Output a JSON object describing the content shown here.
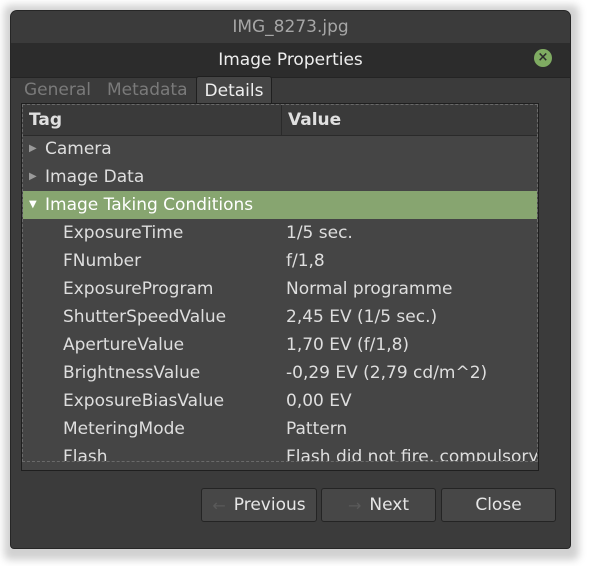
{
  "parent_window": {
    "title": "IMG_8273.jpg"
  },
  "dialog": {
    "title": "Image Properties",
    "close_glyph": "×"
  },
  "tabs": [
    {
      "label": "General",
      "active": false
    },
    {
      "label": "Metadata",
      "active": false
    },
    {
      "label": "Details",
      "active": true
    }
  ],
  "table": {
    "columns": {
      "tag": "Tag",
      "value": "Value"
    },
    "groups": [
      {
        "label": "Camera",
        "expanded": false
      },
      {
        "label": "Image Data",
        "expanded": false
      },
      {
        "label": "Image Taking Conditions",
        "expanded": true
      }
    ],
    "rows": [
      {
        "tag": "ExposureTime",
        "value": "1/5 sec."
      },
      {
        "tag": "FNumber",
        "value": "f/1,8"
      },
      {
        "tag": "ExposureProgram",
        "value": "Normal programme"
      },
      {
        "tag": "ShutterSpeedValue",
        "value": "2,45 EV (1/5 sec.)"
      },
      {
        "tag": "ApertureValue",
        "value": "1,70 EV (f/1,8)"
      },
      {
        "tag": "BrightnessValue",
        "value": "-0,29 EV (2,79 cd/m^2)"
      },
      {
        "tag": "ExposureBiasValue",
        "value": "0,00 EV"
      },
      {
        "tag": "MeteringMode",
        "value": "Pattern"
      },
      {
        "tag": "Flash",
        "value": "Flash did not fire, compulsory"
      }
    ]
  },
  "buttons": {
    "previous": {
      "label": "Previous",
      "icon": "arrow-left-icon"
    },
    "next": {
      "label": "Next",
      "icon": "arrow-right-icon"
    },
    "close": {
      "label": "Close"
    }
  },
  "colors": {
    "selection": "#87a570",
    "close_button": "#7fab62"
  }
}
